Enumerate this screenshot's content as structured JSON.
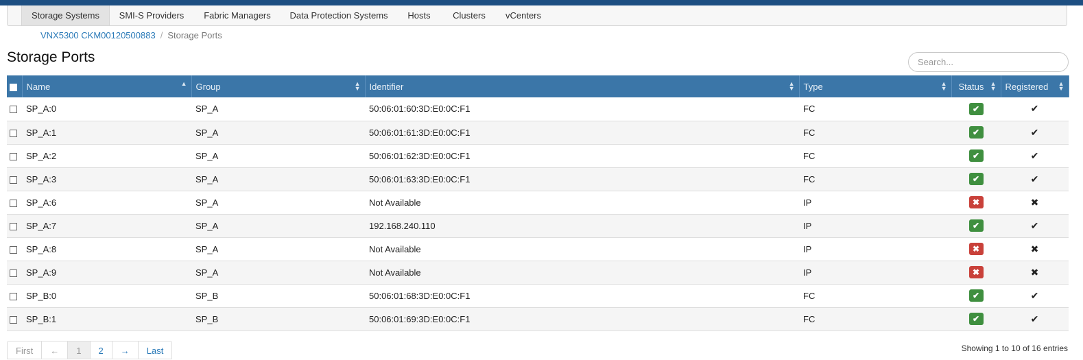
{
  "tabs": [
    {
      "label": "Storage Systems",
      "active": true
    },
    {
      "label": "SMI-S Providers"
    },
    {
      "label": "Fabric Managers"
    },
    {
      "label": "Data Protection Systems"
    },
    {
      "label": "Hosts"
    },
    {
      "label": "Clusters"
    },
    {
      "label": "vCenters"
    }
  ],
  "breadcrumb": {
    "parent": "VNX5300 CKM00120500883",
    "separator": "/",
    "current": "Storage Ports"
  },
  "page_title": "Storage Ports",
  "search": {
    "placeholder": "Search...",
    "value": ""
  },
  "table": {
    "columns": {
      "name": "Name",
      "group": "Group",
      "identifier": "Identifier",
      "type": "Type",
      "status": "Status",
      "registered": "Registered"
    },
    "rows": [
      {
        "name": "SP_A:0",
        "group": "SP_A",
        "identifier": "50:06:01:60:3D:E0:0C:F1",
        "type": "FC",
        "status": "ok",
        "registered": true
      },
      {
        "name": "SP_A:1",
        "group": "SP_A",
        "identifier": "50:06:01:61:3D:E0:0C:F1",
        "type": "FC",
        "status": "ok",
        "registered": true
      },
      {
        "name": "SP_A:2",
        "group": "SP_A",
        "identifier": "50:06:01:62:3D:E0:0C:F1",
        "type": "FC",
        "status": "ok",
        "registered": true
      },
      {
        "name": "SP_A:3",
        "group": "SP_A",
        "identifier": "50:06:01:63:3D:E0:0C:F1",
        "type": "FC",
        "status": "ok",
        "registered": true
      },
      {
        "name": "SP_A:6",
        "group": "SP_A",
        "identifier": "Not Available",
        "type": "IP",
        "status": "error",
        "registered": false
      },
      {
        "name": "SP_A:7",
        "group": "SP_A",
        "identifier": "192.168.240.110",
        "type": "IP",
        "status": "ok",
        "registered": true
      },
      {
        "name": "SP_A:8",
        "group": "SP_A",
        "identifier": "Not Available",
        "type": "IP",
        "status": "error",
        "registered": false
      },
      {
        "name": "SP_A:9",
        "group": "SP_A",
        "identifier": "Not Available",
        "type": "IP",
        "status": "error",
        "registered": false
      },
      {
        "name": "SP_B:0",
        "group": "SP_B",
        "identifier": "50:06:01:68:3D:E0:0C:F1",
        "type": "FC",
        "status": "ok",
        "registered": true
      },
      {
        "name": "SP_B:1",
        "group": "SP_B",
        "identifier": "50:06:01:69:3D:E0:0C:F1",
        "type": "FC",
        "status": "ok",
        "registered": true
      }
    ]
  },
  "pagination": {
    "first": "First",
    "prev": "←",
    "pages": [
      "1",
      "2"
    ],
    "current_page": "1",
    "next": "→",
    "last": "Last"
  },
  "info": "Showing 1 to 10 of 16 entries",
  "icons": {
    "status_ok": "check-icon",
    "status_error": "x-icon",
    "sort": "sort-icon"
  },
  "colors": {
    "header": "#3b76a8",
    "ok": "#3f8f3f",
    "error": "#c9413a",
    "link": "#2a7ab8"
  }
}
